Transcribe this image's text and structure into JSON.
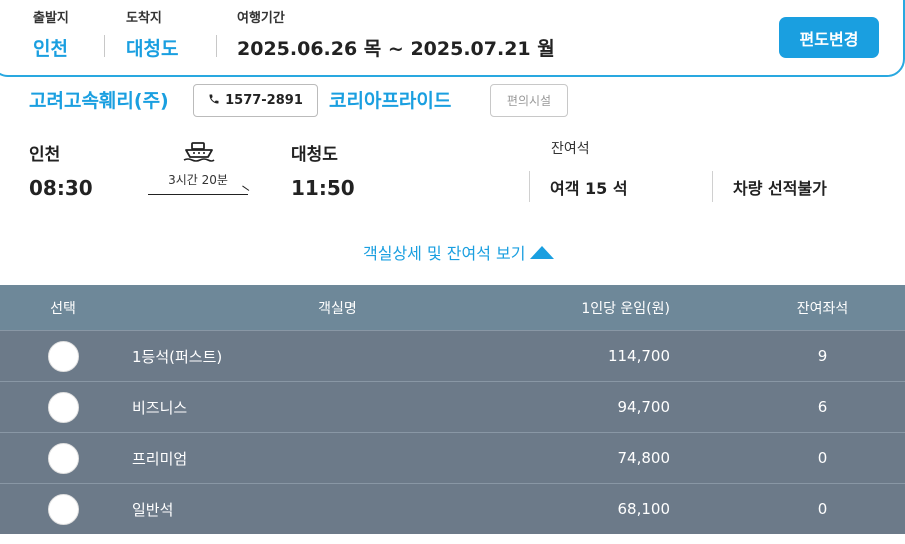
{
  "summary": {
    "departure_label": "출발지",
    "departure_value": "인천",
    "arrival_label": "도착지",
    "arrival_value": "대청도",
    "period_label": "여행기간",
    "period_value": "2025.06.26 목 ~ 2025.07.21 월",
    "change_button": "편도변경"
  },
  "company": {
    "name": "고려고속훼리(주)",
    "phone": "1577-2891",
    "ship": "코리아프라이드",
    "facilities_button": "편의시설"
  },
  "schedule": {
    "from_port": "인천",
    "from_time": "08:30",
    "to_port": "대청도",
    "to_time": "11:50",
    "duration": "3시간 20분",
    "remaining_label": "잔여석",
    "passenger_remaining": "여객 15 석",
    "vehicle_remaining": "차량 선적불가"
  },
  "detail_toggle": "객실상세 및 잔여석 보기",
  "table": {
    "headers": [
      "선택",
      "객실명",
      "1인당 운임(원)",
      "잔여좌석"
    ],
    "rows": [
      {
        "name": "1등석(퍼스트)",
        "fare": "114,700",
        "seats": "9"
      },
      {
        "name": "비즈니스",
        "fare": "94,700",
        "seats": "6"
      },
      {
        "name": "프리미엄",
        "fare": "74,800",
        "seats": "0"
      },
      {
        "name": "일반석",
        "fare": "68,100",
        "seats": "0"
      }
    ]
  },
  "colors": {
    "accent": "#1a9fe0",
    "table_header": "#6e8899",
    "table_row": "#6c7a89"
  }
}
